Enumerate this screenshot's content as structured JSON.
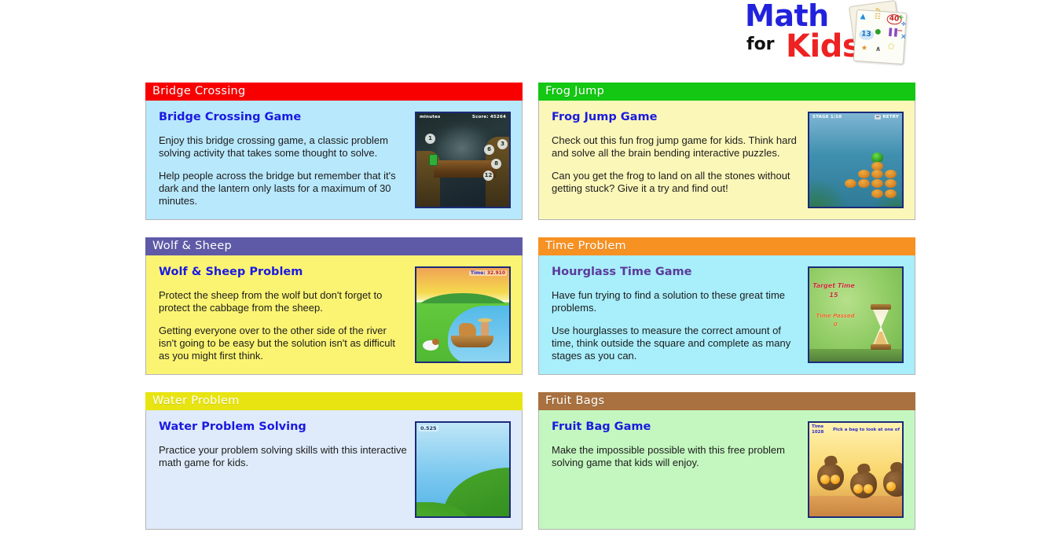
{
  "logo": {
    "word1": "Math",
    "word2": "for",
    "word3": "Kids",
    "card_icons": [
      "÷",
      "×",
      "+",
      "−",
      "40",
      "13",
      "★",
      "▲"
    ]
  },
  "cards": [
    {
      "header": "Bridge Crossing",
      "header_color": "#f80000",
      "body_color": "#b8e8fc",
      "title": "Bridge Crossing Game",
      "title_color": "#1a1ae0",
      "paragraphs": [
        "Enjoy this bridge crossing game, a classic problem solving activity that takes some thought to solve.",
        "Help people across the bridge but remember that it's dark and the lantern only lasts for a maximum of 30 minutes."
      ],
      "thumb": {
        "kind": "bridge",
        "hud_left": "minutes",
        "hud_right": "Score:  45264",
        "pebbles": [
          "1",
          "6",
          "3",
          "8",
          "12"
        ]
      }
    },
    {
      "header": "Frog Jump",
      "header_color": "#13c713",
      "body_color": "#fbf7b8",
      "title": "Frog Jump Game",
      "title_color": "#1a1ae0",
      "paragraphs": [
        "Check out this fun frog jump game for kids. Think hard and solve all the brain bending interactive puzzles.",
        "Can you get the frog to land on all the stones without getting stuck? Give it a try and find out!"
      ],
      "thumb": {
        "kind": "frog",
        "hud_left": "STAGE 1/10",
        "hud_right": "RETRY"
      }
    },
    {
      "header": "Wolf & Sheep",
      "header_color": "#5f5aa8",
      "body_color": "#fbf472",
      "title": "Wolf & Sheep Problem",
      "title_color": "#1a1ae0",
      "paragraphs": [
        "Protect the sheep from the wolf but don't forget to protect the cabbage from the sheep.",
        "Getting everyone over to the other side of the river isn't going to be easy but the solution isn't as difficult as you might first think."
      ],
      "thumb": {
        "kind": "wolf",
        "hud_label": "Time:",
        "hud_value": "32.910"
      }
    },
    {
      "header": "Time Problem",
      "header_color": "#f79122",
      "body_color": "#a8eefb",
      "title": "Hourglass Time Game",
      "title_color": "#5b3a9b",
      "paragraphs": [
        "Have fun trying to find a solution to these great time problems.",
        "Use hourglasses to measure the correct amount of time, think outside the square and complete as many stages as you can."
      ],
      "thumb": {
        "kind": "hourglass",
        "target_label": "Target Time",
        "target_value": "15",
        "passed_label": "Time Passed",
        "passed_value": "0"
      }
    },
    {
      "header": "Water Problem",
      "header_color": "#e8e411",
      "body_color": "#dfebfb",
      "title": "Water Problem Solving",
      "title_color": "#1a1ae0",
      "paragraphs": [
        "Practice your problem solving skills with this interactive math game for kids."
      ],
      "thumb": {
        "kind": "water",
        "readout": "0.525"
      }
    },
    {
      "header": "Fruit Bags",
      "header_color": "#a8713f",
      "body_color": "#c4f7c0",
      "title": "Fruit Bag Game",
      "title_color": "#1a1ae0",
      "paragraphs": [
        "Make the impossible possible with this free problem solving game that kids will enjoy."
      ],
      "thumb": {
        "kind": "fruit",
        "hud_time_label": "Time",
        "hud_time_value": "1028",
        "hud_message": "Pick a bag to look at one of t"
      }
    }
  ]
}
